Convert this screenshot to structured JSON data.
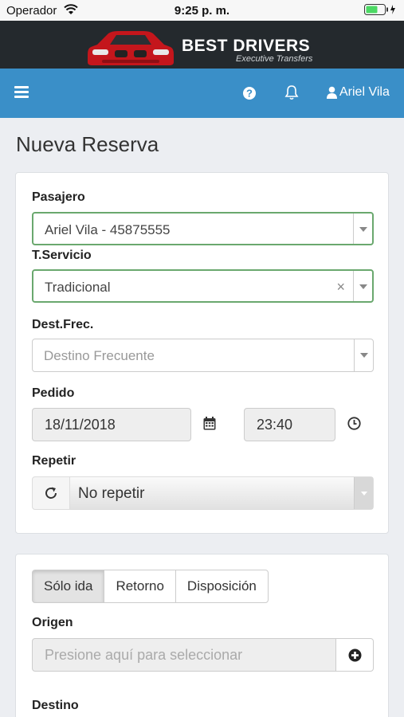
{
  "status_bar": {
    "carrier": "Operador",
    "time": "9:25 p. m."
  },
  "brand": {
    "name": "BEST DRIVERS",
    "tagline": "Executive Transfers"
  },
  "navbar": {
    "user_name": "Ariel Vila"
  },
  "page": {
    "title": "Nueva Reserva"
  },
  "form": {
    "pasajero": {
      "label": "Pasajero",
      "value": "Ariel Vila - 45875555"
    },
    "servicio": {
      "label": "T.Servicio",
      "value": "Tradicional",
      "clear": "×"
    },
    "destino_frecuente": {
      "label": "Dest.Frec.",
      "placeholder": "Destino Frecuente"
    },
    "pedido": {
      "label": "Pedido",
      "date": "18/11/2018",
      "time": "23:40"
    },
    "repetir": {
      "label": "Repetir",
      "value": "No repetir"
    }
  },
  "trip": {
    "tabs": [
      {
        "label": "Sólo ida",
        "active": true
      },
      {
        "label": "Retorno",
        "active": false
      },
      {
        "label": "Disposición",
        "active": false
      }
    ],
    "origen": {
      "label": "Origen",
      "placeholder": "Presione aquí para seleccionar"
    },
    "destino": {
      "label": "Destino"
    }
  },
  "icons": {
    "menu": "menu-icon",
    "help": "question-circle-icon",
    "bell": "bell-icon",
    "user": "user-icon",
    "calendar": "calendar-icon",
    "clock": "clock-icon",
    "refresh": "refresh-icon",
    "add": "plus-circle-icon"
  },
  "colors": {
    "navbar": "#3a8fc8",
    "brand_bg": "#24292d",
    "valid_border": "#6aa86e",
    "battery": "#4cd964"
  }
}
